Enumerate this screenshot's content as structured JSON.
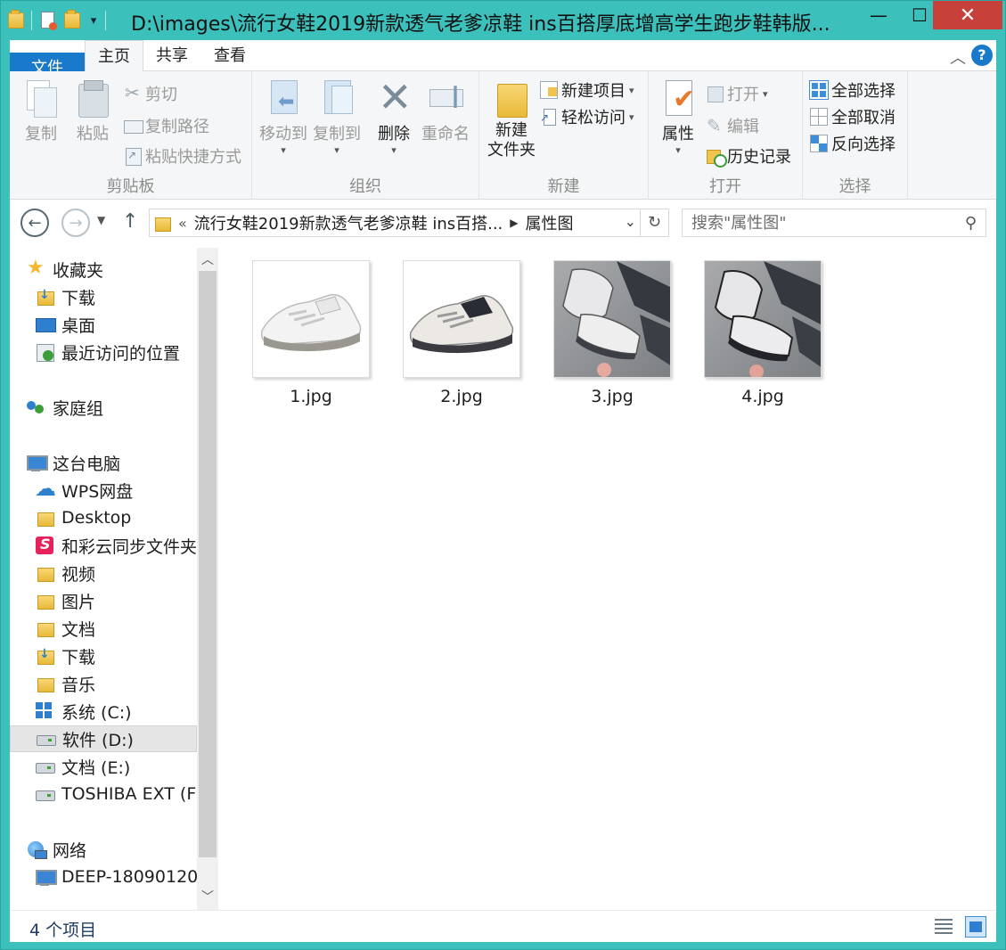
{
  "window": {
    "title": "D:\\images\\流行女鞋2019新款透气老爹凉鞋 ins百搭厚底增高学生跑步鞋韩版...",
    "minimize": "—",
    "maximize": "☐",
    "close": "✕"
  },
  "tabs": {
    "file": "文件",
    "home": "主页",
    "share": "共享",
    "view": "查看",
    "collapse": "︿",
    "help": "?"
  },
  "ribbon": {
    "clipboard": {
      "label": "剪贴板",
      "copy": "复制",
      "paste": "粘贴",
      "cut": "剪切",
      "copy_path": "复制路径",
      "paste_shortcut": "粘贴快捷方式"
    },
    "organize": {
      "label": "组织",
      "move_to": "移动到",
      "copy_to": "复制到",
      "delete": "删除",
      "rename": "重命名"
    },
    "new": {
      "label": "新建",
      "new_folder_line1": "新建",
      "new_folder_line2": "文件夹",
      "new_item": "新建项目",
      "easy_access": "轻松访问"
    },
    "open": {
      "label": "打开",
      "properties": "属性",
      "open": "打开",
      "edit": "编辑",
      "history": "历史记录"
    },
    "select": {
      "label": "选择",
      "select_all": "全部选择",
      "select_none": "全部取消",
      "invert": "反向选择"
    }
  },
  "address": {
    "overflow": "«",
    "segments": [
      "流行女鞋2019新款透气老爹凉鞋 ins百搭...",
      "属性图"
    ],
    "search_placeholder": "搜索\"属性图\""
  },
  "nav": {
    "favorites": "收藏夹",
    "downloads": "下载",
    "desktop": "桌面",
    "recent": "最近访问的位置",
    "homegroup": "家庭组",
    "this_pc": "这台电脑",
    "wps": "WPS网盘",
    "desktop_en": "Desktop",
    "hecaiyun": "和彩云同步文件夹",
    "videos": "视频",
    "pictures": "图片",
    "documents": "文档",
    "downloads2": "下载",
    "music": "音乐",
    "drive_c": "系统 (C:)",
    "drive_d": "软件 (D:)",
    "drive_e": "文档 (E:)",
    "drive_f": "TOSHIBA EXT (F:)",
    "network": "网络",
    "network_pc": "DEEP-18090120"
  },
  "files": [
    {
      "name": "1.jpg"
    },
    {
      "name": "2.jpg"
    },
    {
      "name": "3.jpg"
    },
    {
      "name": "4.jpg"
    }
  ],
  "status": {
    "count": "4 个项目"
  },
  "colors": {
    "frame": "#3cc0bc",
    "file_tab": "#1979ca",
    "close": "#c7403a"
  }
}
